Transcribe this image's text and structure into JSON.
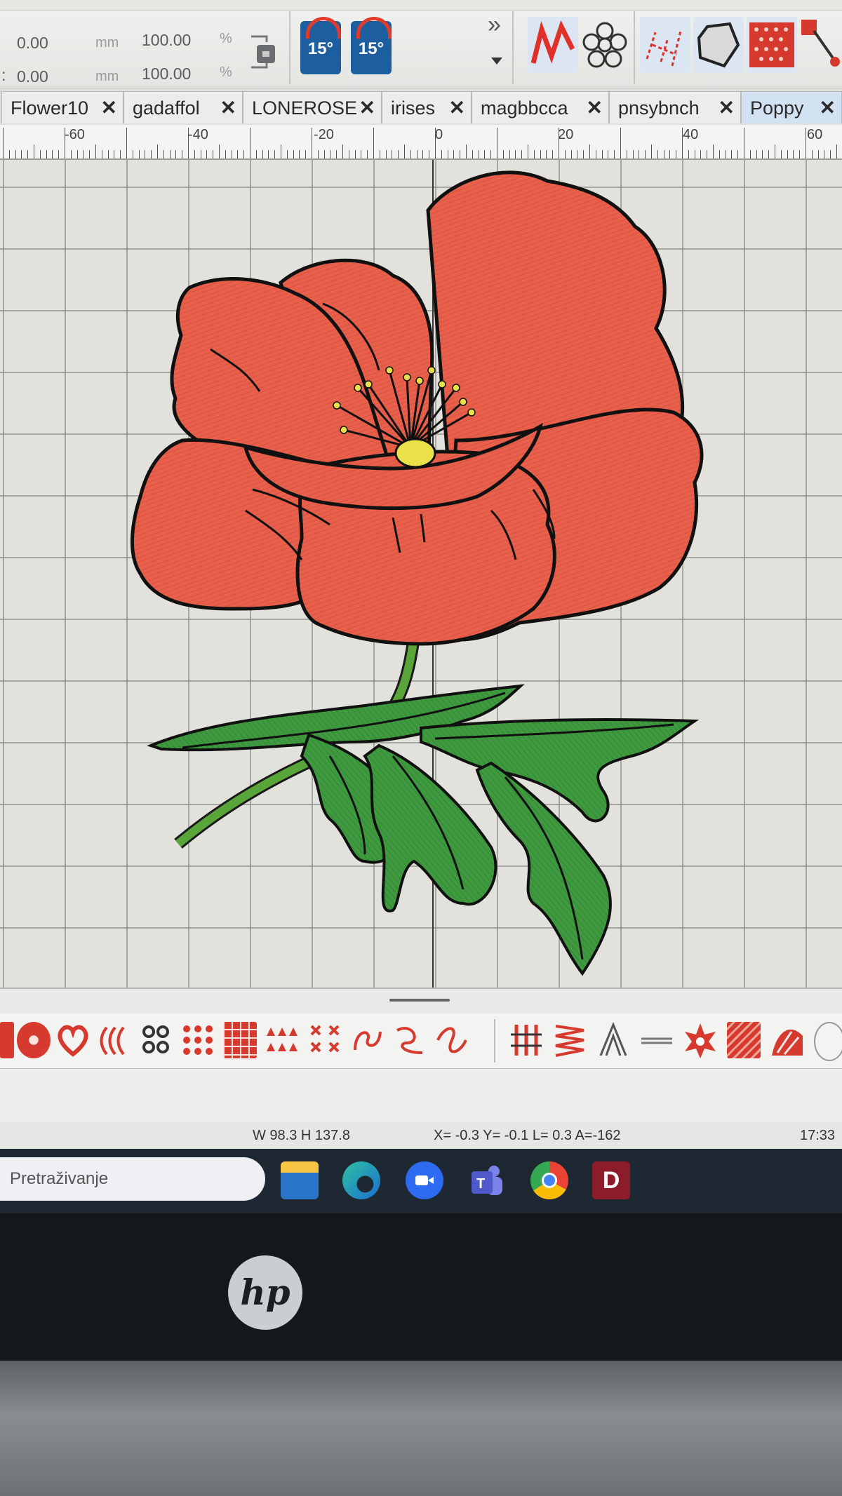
{
  "toolbar": {
    "x_value": "0.00",
    "y_value": "0.00",
    "x_prefix": "",
    "y_prefix": ":",
    "unit_mm": "mm",
    "scale_w": "100.00",
    "scale_h": "100.00",
    "unit_pct": "%",
    "rotate_ccw_label": "15°",
    "rotate_cw_label": "15°",
    "more_icon": "chevron-double-down-icon"
  },
  "tabs": [
    {
      "label": "Flower10",
      "active": false
    },
    {
      "label": "gadaffol",
      "active": false
    },
    {
      "label": "LONEROSE",
      "active": false
    },
    {
      "label": "irises",
      "active": false
    },
    {
      "label": "magbbcca",
      "active": false
    },
    {
      "label": "pnsybnch",
      "active": false
    },
    {
      "label": "Poppy",
      "active": true
    }
  ],
  "ruler": {
    "labels": [
      "-60",
      "-40",
      "-20",
      "0",
      "20",
      "40",
      "60"
    ]
  },
  "design": {
    "petal_color": "#e8604c",
    "petal_dark": "#d24a38",
    "outline_color": "#1a1a1a",
    "center_color": "#e9e04a",
    "leaf_color": "#3f9a3f",
    "stem_color": "#5aa53a"
  },
  "status": {
    "size": "W  98.3 H 137.8",
    "coords": "X=  -0.3 Y=   -0.1 L=   0.3 A=-162",
    "time": "17:33"
  },
  "taskbar": {
    "search_placeholder": "Pretraživanje",
    "apps": [
      "file-explorer-icon",
      "edge-icon",
      "zoom-icon",
      "teams-icon",
      "chrome-icon",
      "embroidery-app-icon"
    ]
  },
  "laptop": {
    "brand": "hp"
  }
}
